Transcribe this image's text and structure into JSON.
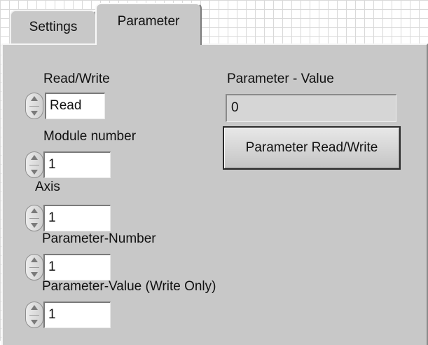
{
  "tabs": [
    {
      "label": "Settings",
      "active": false
    },
    {
      "label": "Parameter",
      "active": true
    }
  ],
  "controls": {
    "read_write": {
      "label": "Read/Write",
      "value": "Read"
    },
    "module_number": {
      "label": "Module number",
      "value": "1"
    },
    "axis": {
      "label": "Axis",
      "value": "1"
    },
    "parameter_number": {
      "label": "Parameter-Number",
      "value": "1"
    },
    "parameter_value_write": {
      "label": "Parameter-Value (Write Only)",
      "value": "1"
    }
  },
  "indicator": {
    "label": "Parameter - Value",
    "value": "0"
  },
  "button": {
    "label": "Parameter Read/Write"
  },
  "colors": {
    "panel": "#c8c8c8",
    "grid": "#d9d9d9",
    "indicator_bg": "#d6d6d6"
  }
}
